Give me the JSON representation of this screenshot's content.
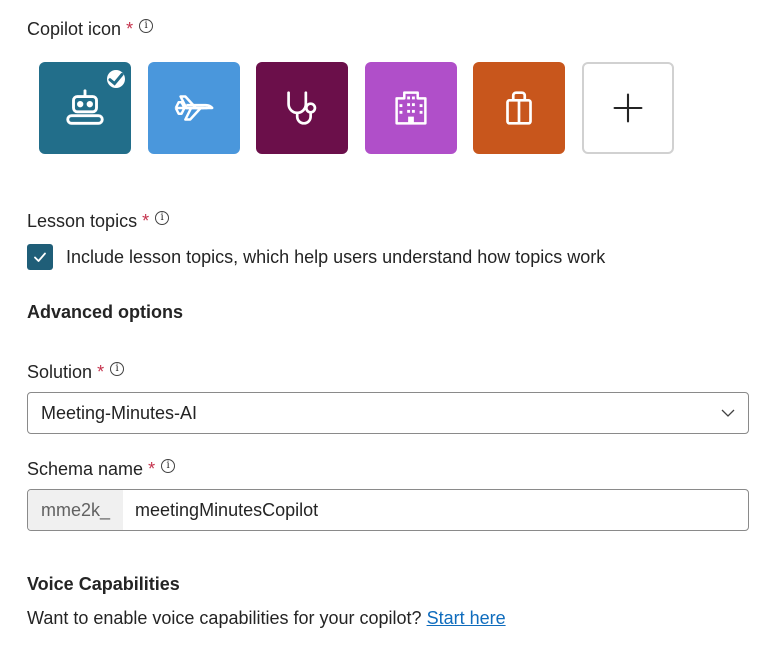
{
  "copilot_icon": {
    "label": "Copilot icon",
    "required_mark": "*",
    "info": "i",
    "tiles": [
      {
        "name": "robot",
        "color": "#226e8a",
        "selected": true
      },
      {
        "name": "airplane",
        "color": "#4a97dc",
        "selected": false
      },
      {
        "name": "stethoscope",
        "color": "#6b0f4a",
        "selected": false
      },
      {
        "name": "building",
        "color": "#b04fc9",
        "selected": false
      },
      {
        "name": "gift",
        "color": "#c8561c",
        "selected": false
      },
      {
        "name": "add",
        "color": "#ffffff",
        "selected": false
      }
    ],
    "add_glyph": "+"
  },
  "lesson_topics": {
    "label": "Lesson topics",
    "required_mark": "*",
    "info": "i",
    "checkbox_checked": true,
    "checkbox_text": "Include lesson topics, which help users understand how topics work"
  },
  "advanced_options": {
    "heading": "Advanced options"
  },
  "solution": {
    "label": "Solution",
    "required_mark": "*",
    "info": "i",
    "selected_value": "Meeting-Minutes-AI"
  },
  "schema_name": {
    "label": "Schema name",
    "required_mark": "*",
    "info": "i",
    "prefix": "mme2k_",
    "value": "meetingMinutesCopilot"
  },
  "voice": {
    "heading": "Voice Capabilities",
    "text": "Want to enable voice capabilities for your copilot?",
    "link_text": "Start here"
  },
  "colors": {
    "accent": "#1f5e78",
    "link": "#0f6cbd",
    "required": "#c4314b"
  }
}
